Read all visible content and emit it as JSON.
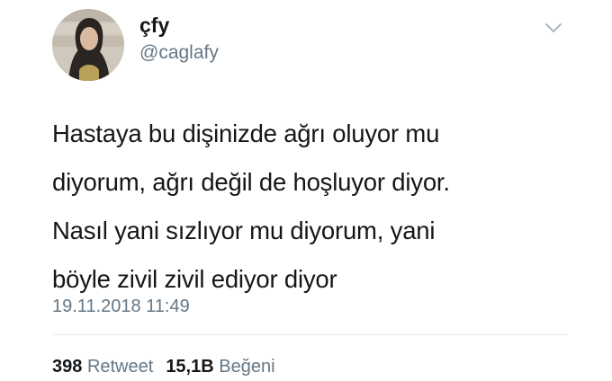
{
  "tweet": {
    "display_name": "çfy",
    "handle": "@caglafy",
    "text_lines": [
      "Hastaya bu dişinizde ağrı oluyor mu",
      "diyorum, ağrı değil de hoşluyor diyor.",
      "Nasıl yani sızlıyor mu diyorum, yani",
      "böyle zivil zivil ediyor diyor"
    ],
    "timestamp": "19.11.2018 11:49",
    "stats": {
      "retweets_count": "398",
      "retweets_label": "Retweet",
      "likes_count": "15,1B",
      "likes_label": "Beğeni"
    },
    "menu_icon": "chevron-down-icon",
    "colors": {
      "text": "#14171a",
      "secondary_text": "#657786",
      "divider": "#e1e8ed"
    }
  }
}
